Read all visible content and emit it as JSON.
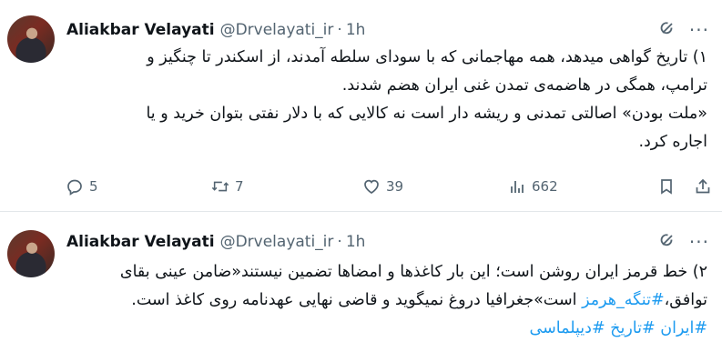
{
  "tweets": [
    {
      "author_name": "Aliakbar Velayati",
      "handle": "@Drvelayati_ir",
      "separator": "·",
      "time": "1h",
      "body_lines": [
        "۱) تاریخ گواهی میدهد، همه مهاجمانی که با سودای سلطه آمدند، از اسکندر تا چنگیز و",
        "ترامپ، همگی در هاضمه‌ی تمدن غنی ایران هضم شدند.",
        "«ملت بودن» اصالتی تمدنی و ریشه دار است نه کالایی که با دلار نفتی بتوان خرید و یا",
        "اجاره کرد."
      ],
      "stats": {
        "replies": "5",
        "reposts": "7",
        "likes": "39",
        "views": "662"
      }
    },
    {
      "author_name": "Aliakbar Velayati",
      "handle": "@Drvelayati_ir",
      "separator": "·",
      "time": "1h",
      "line1": "۲) خط قرمز ایران روشن است؛ این بار کاغذها و امضاها تضمین نیستند«ضامن عینی بقای",
      "line2_prefix": "توافق،",
      "line2_hashtag": "#تنگه_هرمز",
      "line2_suffix": " است»جغرافیا دروغ نمیگوید و قاضی نهایی عهدنامه روی کاغذ است.",
      "hashtags_line": "#ایران #تاریخ #دیپلماسی"
    }
  ],
  "icons": {
    "grok": "grok-icon",
    "more": "more-icon",
    "reply": "reply-icon",
    "repost": "repost-icon",
    "like": "like-icon",
    "views": "views-icon",
    "bookmark": "bookmark-icon",
    "share": "share-icon"
  },
  "more_glyph": "···",
  "colors": {
    "link": "#1d9bf0",
    "secondary": "#536471",
    "text": "#0f1419"
  }
}
